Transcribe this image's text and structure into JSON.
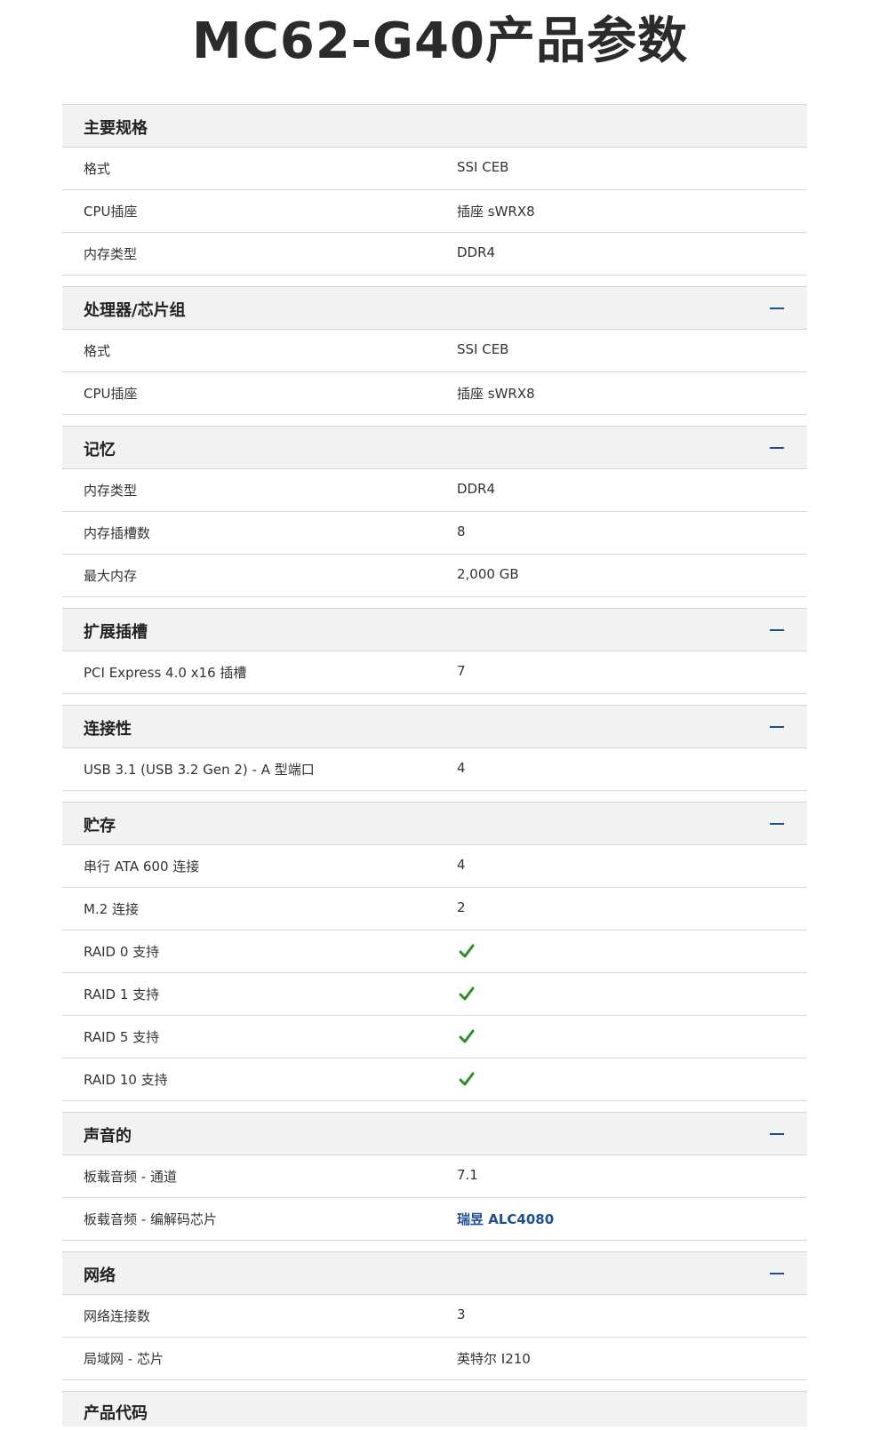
{
  "page": {
    "title": "MC62-G40产品参数"
  },
  "colors": {
    "accent": "#1d4f91",
    "check": "#2e8b2e",
    "header_bg": "#f2f2f2"
  },
  "sections": [
    {
      "title": "主要规格",
      "collapsible": false,
      "rows": [
        {
          "label": "格式",
          "value": "SSI CEB"
        },
        {
          "label": "CPU插座",
          "value": "插座 sWRX8"
        },
        {
          "label": "内存类型",
          "value": "DDR4"
        }
      ]
    },
    {
      "title": "处理器/芯片组",
      "collapsible": true,
      "rows": [
        {
          "label": "格式",
          "value": "SSI CEB"
        },
        {
          "label": "CPU插座",
          "value": "插座 sWRX8"
        }
      ]
    },
    {
      "title": "记忆",
      "collapsible": true,
      "rows": [
        {
          "label": "内存类型",
          "value": "DDR4"
        },
        {
          "label": "内存插槽数",
          "value": "8"
        },
        {
          "label": "最大内存",
          "value": "2,000 GB"
        }
      ]
    },
    {
      "title": "扩展插槽",
      "collapsible": true,
      "rows": [
        {
          "label": "PCI Express 4.0 x16 插槽",
          "value": "7"
        }
      ]
    },
    {
      "title": "连接性",
      "collapsible": true,
      "rows": [
        {
          "label": "USB 3.1 (USB 3.2 Gen 2) - A 型端口",
          "value": "4"
        }
      ]
    },
    {
      "title": "贮存",
      "collapsible": true,
      "rows": [
        {
          "label": "串行 ATA 600 连接",
          "value": "4"
        },
        {
          "label": "M.2 连接",
          "value": "2"
        },
        {
          "label": "RAID 0 支持",
          "icon": "check-icon"
        },
        {
          "label": "RAID 1 支持",
          "icon": "check-icon"
        },
        {
          "label": "RAID 5 支持",
          "icon": "check-icon"
        },
        {
          "label": "RAID 10 支持",
          "icon": "check-icon"
        }
      ]
    },
    {
      "title": "声音的",
      "collapsible": true,
      "rows": [
        {
          "label": "板载音频 - 通道",
          "value": "7.1"
        },
        {
          "label": "板载音频 - 编解码芯片",
          "value": "瑞昱 ALC4080",
          "link": true
        }
      ]
    },
    {
      "title": "网络",
      "collapsible": true,
      "rows": [
        {
          "label": "网络连接数",
          "value": "3"
        },
        {
          "label": "局域网 - 芯片",
          "value": "英特尔 I210"
        }
      ]
    }
  ],
  "cut_section": {
    "title": "产品代码"
  }
}
